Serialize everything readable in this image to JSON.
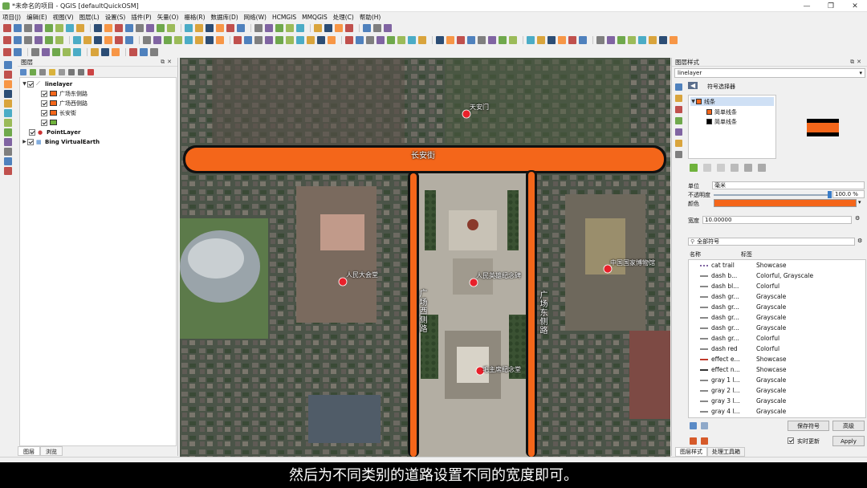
{
  "window": {
    "title": "*未命名的项目 - QGIS [defaultQuickOSM]",
    "controls": [
      "—",
      "❐",
      "✕"
    ]
  },
  "menu": [
    "项目(J)",
    "编辑(E)",
    "视图(V)",
    "图层(L)",
    "设置(S)",
    "插件(P)",
    "矢量(O)",
    "栅格(R)",
    "数据库(D)",
    "网络(W)",
    "HCMGIS",
    "MMQGIS",
    "处理(C)",
    "帮助(H)"
  ],
  "layers_panel": {
    "title": "图层",
    "tabs": [
      "图层",
      "浏览"
    ],
    "items": [
      {
        "label": "linelayer",
        "level": 0,
        "checked": true,
        "bold": true
      },
      {
        "label": "广场东侧路",
        "level": 1,
        "checked": true,
        "color": "#f4661a"
      },
      {
        "label": "广场西侧路",
        "level": 1,
        "checked": true,
        "color": "#f4661a"
      },
      {
        "label": "长安街",
        "level": 1,
        "checked": true,
        "color": "#f4661a"
      },
      {
        "label": "",
        "level": 1,
        "checked": true,
        "color": "#6fb23c"
      },
      {
        "label": "PointLayer",
        "level": 0,
        "checked": true,
        "bold": true
      },
      {
        "label": "Bing VirtualEarth",
        "level": 0,
        "checked": true,
        "bold": true
      }
    ]
  },
  "map": {
    "road_labels": {
      "horizontal": "长安街",
      "west": "广场西侧路",
      "east": "广场东侧路"
    },
    "points": [
      "天安门",
      "人民大会堂",
      "人民英雄纪念碑",
      "中国国家博物馆",
      "毛主席纪念堂"
    ],
    "road_color": "#f4661a",
    "point_color": "#e8202a"
  },
  "style_panel": {
    "title": "图层样式",
    "layer": "linelayer",
    "symbol_selector": "符号选择器",
    "tree": {
      "root": "线条",
      "children": [
        "简单线条",
        "简单线条"
      ]
    },
    "unit_label": "单位",
    "unit_value": "毫米",
    "opacity_label": "不透明度",
    "opacity_value": "100.0 %",
    "opacity": 1.0,
    "color_label": "颜色",
    "width_label": "宽度",
    "width_value": "10.00000",
    "search_placeholder": "全部符号",
    "columns": {
      "name": "名称",
      "tag": "标签"
    },
    "symbols": [
      {
        "name": "cat trail",
        "tag": "Showcase"
      },
      {
        "name": "dash b...",
        "tag": "Colorful, Grayscale"
      },
      {
        "name": "dash bl...",
        "tag": "Colorful"
      },
      {
        "name": "dash gr...",
        "tag": "Grayscale"
      },
      {
        "name": "dash gr...",
        "tag": "Grayscale"
      },
      {
        "name": "dash gr...",
        "tag": "Grayscale"
      },
      {
        "name": "dash gr...",
        "tag": "Grayscale"
      },
      {
        "name": "dash gr...",
        "tag": "Colorful"
      },
      {
        "name": "dash red",
        "tag": "Colorful"
      },
      {
        "name": "effect e...",
        "tag": "Showcase"
      },
      {
        "name": "effect n...",
        "tag": "Showcase"
      },
      {
        "name": "gray 1 l...",
        "tag": "Grayscale"
      },
      {
        "name": "gray 2 l...",
        "tag": "Grayscale"
      },
      {
        "name": "gray 3 l...",
        "tag": "Grayscale"
      },
      {
        "name": "gray 4 l...",
        "tag": "Grayscale"
      }
    ],
    "save_symbol": "保存符号",
    "advanced": "高级",
    "live_update": "实时更新",
    "apply": "Apply",
    "tabs": [
      "图层样式",
      "处理工具箱"
    ]
  },
  "subtitle": "然后为不同类别的道路设置不同的宽度即可。"
}
